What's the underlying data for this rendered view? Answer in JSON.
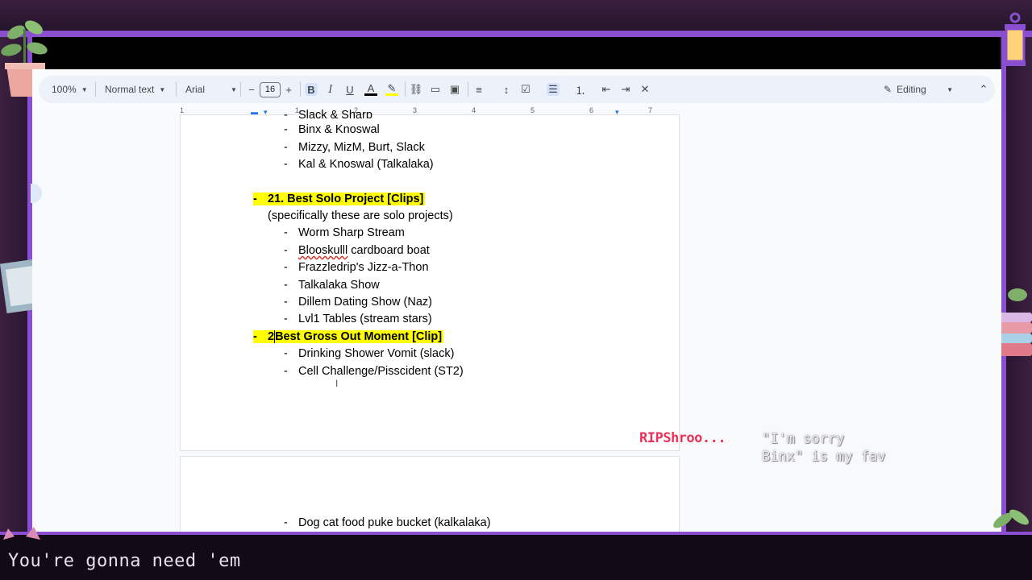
{
  "toolbar": {
    "zoom": "100%",
    "style": "Normal text",
    "font": "Arial",
    "font_size": "16",
    "mode": "Editing"
  },
  "ruler": [
    "1",
    "2",
    "3",
    "4",
    "5",
    "6",
    "7"
  ],
  "document": {
    "partial_top": "Slack & Sharp",
    "group1": [
      "Binx & Knoswal",
      "Mizzy, MizM, Burt, Slack",
      "Kal & Knoswal (Talkalaka)"
    ],
    "heading21": "21. Best Solo Project [Clips]",
    "note21": "(specifically these are solo projects)",
    "items21": [
      "Worm Sharp Stream",
      "cardboard boat",
      "Frazzledrip's Jizz-a-Thon",
      "Talkalaka Show",
      "Dillem Dating Show (Naz)",
      "Lvl1 Tables (stream stars)"
    ],
    "items21_misspelled": "Blooskulll",
    "heading22_prefix": "2",
    "heading22": "Best Gross Out Moment [Clip]",
    "items22": [
      "Drinking Shower Vomit (slack)",
      "Cell Challenge/Pisscident (ST2)"
    ],
    "page2_item": "Dog cat food puke bucket (kalkalaka)",
    "bullet": "-"
  },
  "chat": {
    "user": "RIPShroo...",
    "message_line1": "\"I'm sorry",
    "message_line2": "Binx\" is my fav"
  },
  "caption": "You're gonna need 'em",
  "colors": {
    "highlight": "#ffff00",
    "overlay_purple": "#8a4fd0",
    "chat_user": "#e8325a"
  }
}
